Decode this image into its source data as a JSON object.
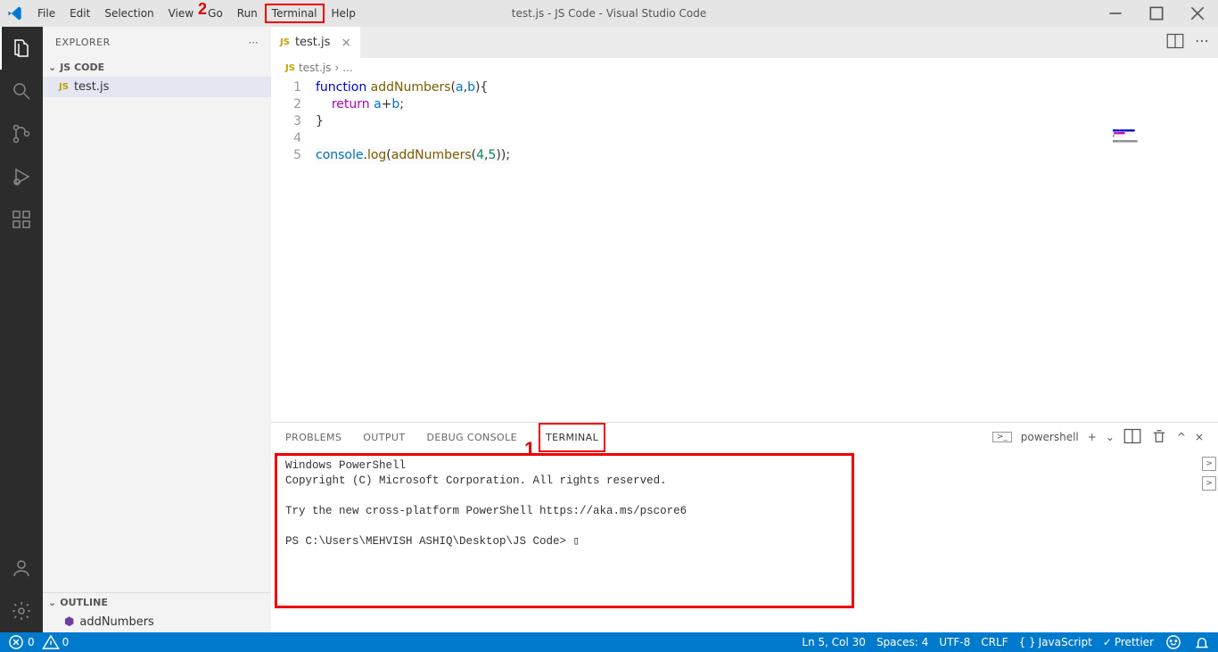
{
  "title": "test.js - JS Code - Visual Studio Code",
  "menu": [
    "File",
    "Edit",
    "Selection",
    "View",
    "Go",
    "Run",
    "Terminal",
    "Help"
  ],
  "sidebar": {
    "header": "EXPLORER",
    "project": "JS CODE",
    "file": "test.js",
    "outline_header": "OUTLINE",
    "outline_item": "addNumbers"
  },
  "tab": {
    "name": "test.js"
  },
  "breadcrumb": {
    "file": "test.js",
    "sep": "›",
    "rest": "..."
  },
  "code": {
    "lines": [
      "1",
      "2",
      "3",
      "4",
      "5"
    ],
    "l1a": "function",
    "l1b": "addNumbers",
    "l1c": "(",
    "l1d": "a",
    "l1e": ",",
    "l1f": "b",
    "l1g": "){",
    "l2a": "return",
    "l2b": "a",
    "l2c": "+",
    "l2d": "b",
    "l2e": ";",
    "l3": "}",
    "l5a": "console",
    "l5b": ".",
    "l5c": "log",
    "l5d": "(",
    "l5e": "addNumbers",
    "l5f": "(",
    "l5g": "4",
    "l5h": ",",
    "l5i": "5",
    "l5j": "));"
  },
  "panel": {
    "tabs": [
      "PROBLEMS",
      "OUTPUT",
      "DEBUG CONSOLE",
      "TERMINAL"
    ],
    "shell": "powershell",
    "content": "Windows PowerShell\nCopyright (C) Microsoft Corporation. All rights reserved.\n\nTry the new cross-platform PowerShell https://aka.ms/pscore6\n\nPS C:\\Users\\MEHVISH ASHIQ\\Desktop\\JS Code> ▯"
  },
  "status": {
    "errors": "0",
    "warnings": "0",
    "pos": "Ln 5, Col 30",
    "spaces": "Spaces: 4",
    "enc": "UTF-8",
    "eol": "CRLF",
    "lang": "JavaScript",
    "prettier": "Prettier"
  },
  "annotations": {
    "one": "1",
    "two": "2"
  }
}
